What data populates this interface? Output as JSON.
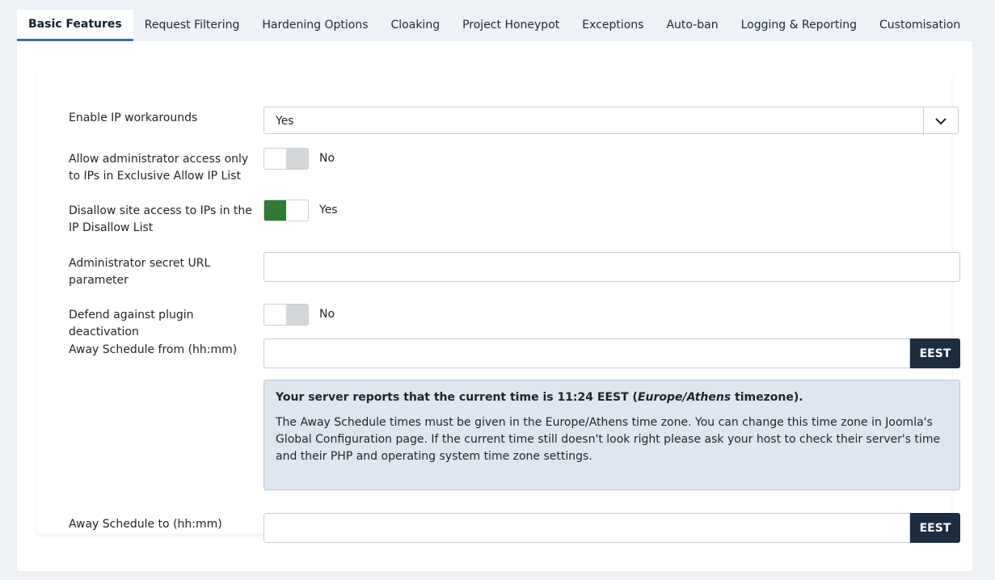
{
  "tabs": [
    {
      "label": "Basic Features"
    },
    {
      "label": "Request Filtering"
    },
    {
      "label": "Hardening Options"
    },
    {
      "label": "Cloaking"
    },
    {
      "label": "Project Honeypot"
    },
    {
      "label": "Exceptions"
    },
    {
      "label": "Auto-ban"
    },
    {
      "label": "Logging & Reporting"
    },
    {
      "label": "Customisation"
    }
  ],
  "fields": {
    "ip_workarounds": {
      "label": "Enable IP workarounds",
      "value": "Yes"
    },
    "admin_exclusive": {
      "label": "Allow administrator access only to IPs in Exclusive Allow IP List",
      "value": "No"
    },
    "disallow_site": {
      "label": "Disallow site access to IPs in the IP Disallow List",
      "value": "Yes"
    },
    "secret_url": {
      "label": "Administrator secret URL parameter",
      "value": ""
    },
    "defend_plugin": {
      "label": "Defend against plugin deactivation",
      "value": "No"
    },
    "away_from": {
      "label": "Away Schedule from (hh:mm)",
      "value": "",
      "addon": "EEST"
    },
    "away_to": {
      "label": "Away Schedule to (hh:mm)",
      "value": "",
      "addon": "EEST"
    }
  },
  "notice": {
    "pre": "Your server reports that the current time is ",
    "time": "11:24 EEST",
    "paren_open": " (",
    "tz": "Europe/Athens",
    "post": " timezone).",
    "body": "The Away Schedule times must be given in the Europe/Athens time zone. You can change this time zone in Joomla's Global Configuration page. If the current time still doesn't look right please ask your host to check their server's time and their PHP and operating system time zone settings."
  },
  "colors": {
    "accent": "#3a6ea5",
    "toggle_on": "#2f7a35",
    "addon_bg": "#1d2d41",
    "alert_bg": "#dfe6f0"
  }
}
